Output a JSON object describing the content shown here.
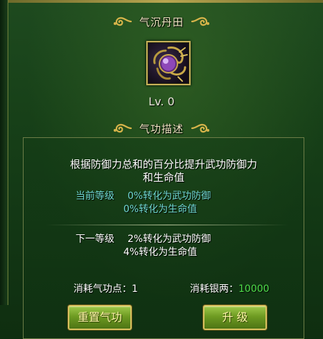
{
  "skill_section": {
    "title": "气沉丹田",
    "level": "Lv. 0"
  },
  "desc_section": {
    "title": "气功描述",
    "line1": "根据防御力总和的百分比提升武功防御力",
    "line2": "和生命值",
    "current_label": "当前等级",
    "current_line1": "0%转化为武功防御",
    "current_line2": "0%转化为生命值",
    "next_label": "下一等级",
    "next_line1": "2%转化为武功防御",
    "next_line2": "4%转化为生命值"
  },
  "costs": {
    "qigong_label": "消耗气功点：",
    "qigong_value": "1",
    "silver_label": "消耗银两：",
    "silver_value": "10000"
  },
  "buttons": {
    "reset": "重置气功",
    "upgrade": "升  级"
  },
  "colors": {
    "current_text": "#6fd6d1",
    "silver_value": "#4fe04a",
    "button_text": "#fff6a8",
    "frame_gold": "#c9b35a"
  },
  "icons": {
    "ornament": "gold-swirl-ornament",
    "skill": "purple-orb-claw-icon"
  }
}
